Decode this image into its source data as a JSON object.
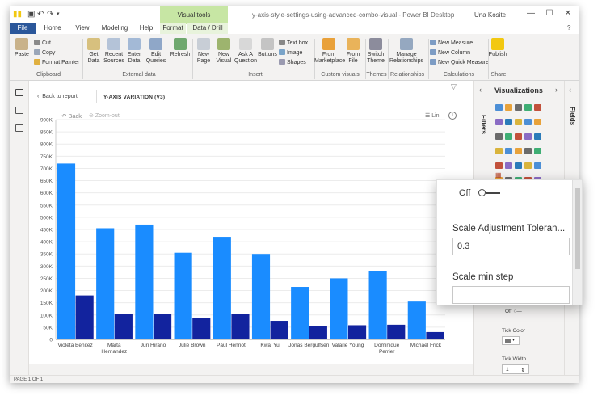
{
  "app": {
    "window_title": "y-axis-style-settings-using-advanced-combo-visual - Power BI Desktop",
    "user": "Una Kosite",
    "visual_tools_label": "Visual tools",
    "window_controls": [
      "—",
      "☐",
      "✕"
    ]
  },
  "tabs": [
    "File",
    "Home",
    "View",
    "Modeling",
    "Help",
    "Format",
    "Data / Drill"
  ],
  "ribbon": {
    "paste": "Paste",
    "clipboard": [
      "Cut",
      "Copy",
      "Format Painter"
    ],
    "get_data": "Get Data",
    "recent_sources": "Recent Sources",
    "enter_data": "Enter Data",
    "edit_queries": "Edit Queries",
    "refresh": "Refresh",
    "new_page": "New Page",
    "new_visual": "New Visual",
    "ask_question": "Ask A Question",
    "buttons": "Buttons",
    "insert_small": [
      "Text box",
      "Image",
      "Shapes"
    ],
    "from_marketplace": "From Marketplace",
    "from_file": "From File",
    "switch_theme": "Switch Theme",
    "manage_relationships": "Manage Relationships",
    "calculations": [
      "New Measure",
      "New Column",
      "New Quick Measure"
    ],
    "publish": "Publish",
    "groups": [
      "Clipboard",
      "External data",
      "Insert",
      "Custom visuals",
      "Themes",
      "Relationships",
      "Calculations",
      "Share"
    ]
  },
  "report": {
    "back": "Back to report",
    "visual_title": "Y-AXIS VARIATION (V3)",
    "back_btn": "Back",
    "zoom_out": "Zoom-out",
    "lin": "Lin",
    "page_status": "PAGE 1 OF 1"
  },
  "panes": {
    "filters": "Filters",
    "visualizations": "Visualizations",
    "fields": "Fields",
    "off_small": "Off",
    "tick_color": "Tick Color",
    "tick_width": "Tick Width",
    "tick_width_value": "1"
  },
  "zoom_panel": {
    "toggle_label": "Off",
    "tolerance_label": "Scale Adjustment Toleran...",
    "tolerance_value": "0.3",
    "min_step_label": "Scale min step"
  },
  "colors": {
    "bar_light": "#1a8cff",
    "bar_dark": "#12239e",
    "file_tab": "#2b579a",
    "visual_tools": "#c7e6a4"
  },
  "chart_data": {
    "type": "bar",
    "categories": [
      "Violeta Benitez",
      "Marta Hernandez",
      "Juri Hirano",
      "Julie Brown",
      "Paul Henriot",
      "Kwai Yu",
      "Jonas Bergulfsen",
      "Valarie Young",
      "Dominique Perrier",
      "Michael Frick"
    ],
    "category_lines": [
      [
        "Violeta Benitez"
      ],
      [
        "Marta",
        "Hernandez"
      ],
      [
        "Juri Hirano"
      ],
      [
        "Julie Brown"
      ],
      [
        "Paul Henriot"
      ],
      [
        "Kwai Yu"
      ],
      [
        "Jonas Bergulfsen"
      ],
      [
        "Valarie Young"
      ],
      [
        "Dominique",
        "Perrier"
      ],
      [
        "Michael Frick"
      ]
    ],
    "series": [
      {
        "values": [
          720000,
          455000,
          470000,
          355000,
          420000,
          350000,
          215000,
          250000,
          280000,
          155000
        ]
      },
      {
        "values": [
          180000,
          105000,
          105000,
          88000,
          105000,
          76000,
          55000,
          58000,
          60000,
          30000
        ]
      }
    ],
    "ylim": [
      0,
      900000
    ],
    "yticks": [
      "0",
      "50K",
      "100K",
      "150K",
      "200K",
      "250K",
      "300K",
      "350K",
      "400K",
      "450K",
      "500K",
      "550K",
      "600K",
      "650K",
      "700K",
      "750K",
      "800K",
      "850K",
      "900K"
    ],
    "grid": true
  }
}
